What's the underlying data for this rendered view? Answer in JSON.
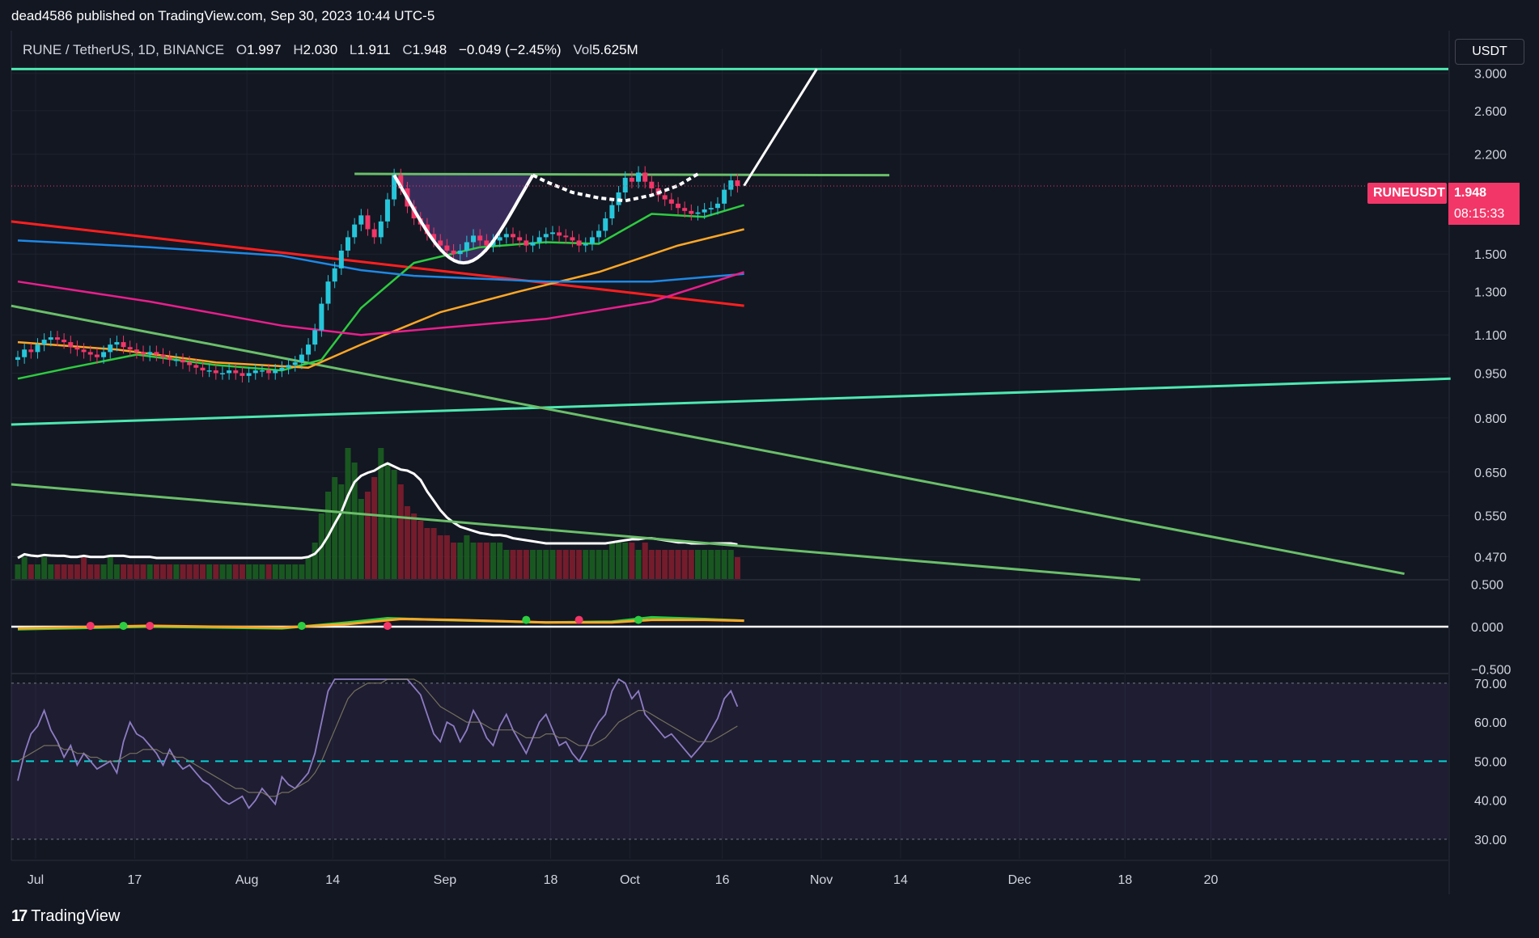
{
  "header": {
    "publish_line": "dead4586 published on TradingView.com, Sep 30, 2023 10:44 UTC-5"
  },
  "legend": {
    "symbol_desc": "RUNE / TetherUS, 1D, BINANCE",
    "o_label": "O",
    "o_value": "1.997",
    "h_label": "H",
    "h_value": "2.030",
    "l_label": "L",
    "l_value": "1.911",
    "c_label": "C",
    "c_value": "1.948",
    "change": "−0.049 (−2.45%)",
    "vol_label": "Vol",
    "vol_value": "5.625M"
  },
  "currency_button": "USDT",
  "last_price": {
    "symbol": "RUNEUSDT",
    "value": "1.948",
    "countdown": "08:15:33"
  },
  "footer": {
    "brand": "TradingView",
    "icon": "tradingview-logo-icon"
  },
  "colors": {
    "background": "#131722",
    "up": "#26c6da",
    "down": "#f23668",
    "resistance": "#4de8b0",
    "neckline": "#6abf69",
    "ma20": "#2ecc40",
    "ma50": "#ffa726",
    "ma100": "#1e88e5",
    "ma200": "#e91e8c",
    "trend_red": "#ff1f1f",
    "rsi": "#8e7cc3",
    "rsi_mid": "#00d4d4"
  },
  "chart_data": [
    {
      "type": "candlestick",
      "panel": "price",
      "scale": "log",
      "ylim": [
        0.43,
        3.3
      ],
      "y_ticks": [
        "3.000",
        "2.600",
        "2.200",
        "1.500",
        "1.300",
        "1.100",
        "0.950",
        "0.800",
        "0.650",
        "0.550",
        "0.470"
      ],
      "x_ticks": [
        "Jul",
        "17",
        "Aug",
        "14",
        "Sep",
        "18",
        "Oct",
        "16",
        "Nov",
        "14",
        "Dec",
        "18",
        "20"
      ],
      "close_series": [
        1.01,
        1.04,
        1.03,
        1.06,
        1.08,
        1.09,
        1.08,
        1.07,
        1.05,
        1.04,
        1.03,
        1.02,
        1.01,
        1.03,
        1.06,
        1.07,
        1.05,
        1.04,
        1.03,
        1.02,
        1.03,
        1.02,
        1.01,
        1.0,
        1.0,
        0.99,
        0.98,
        0.97,
        0.96,
        0.96,
        0.95,
        0.95,
        0.96,
        0.95,
        0.94,
        0.95,
        0.96,
        0.96,
        0.95,
        0.96,
        0.97,
        0.98,
        0.99,
        1.02,
        1.06,
        1.12,
        1.24,
        1.35,
        1.42,
        1.52,
        1.6,
        1.68,
        1.74,
        1.65,
        1.6,
        1.7,
        1.85,
        2.03,
        1.93,
        1.8,
        1.72,
        1.68,
        1.62,
        1.58,
        1.55,
        1.52,
        1.5,
        1.52,
        1.57,
        1.61,
        1.58,
        1.55,
        1.58,
        1.6,
        1.62,
        1.6,
        1.58,
        1.55,
        1.57,
        1.6,
        1.62,
        1.63,
        1.61,
        1.6,
        1.58,
        1.55,
        1.56,
        1.6,
        1.64,
        1.72,
        1.81,
        1.9,
        2.01,
        1.98,
        2.05,
        1.98,
        1.93,
        1.88,
        1.85,
        1.82,
        1.79,
        1.77,
        1.75,
        1.76,
        1.78,
        1.79,
        1.82,
        1.92,
        1.99,
        1.948
      ],
      "series": [
        {
          "name": "",
          "kind": "moving-average",
          "color": "#2ecc40",
          "points": [
            [
              0,
              0.93
            ],
            [
              8,
              0.97
            ],
            [
              18,
              1.02
            ],
            [
              30,
              0.98
            ],
            [
              40,
              0.96
            ],
            [
              46,
              1.0
            ],
            [
              52,
              1.22
            ],
            [
              60,
              1.45
            ],
            [
              70,
              1.54
            ],
            [
              80,
              1.57
            ],
            [
              88,
              1.56
            ],
            [
              96,
              1.75
            ],
            [
              104,
              1.73
            ],
            [
              110,
              1.81
            ]
          ]
        },
        {
          "name": "",
          "kind": "moving-average",
          "color": "#ffa726",
          "points": [
            [
              0,
              1.07
            ],
            [
              15,
              1.04
            ],
            [
              30,
              0.99
            ],
            [
              44,
              0.97
            ],
            [
              52,
              1.06
            ],
            [
              64,
              1.2
            ],
            [
              76,
              1.3
            ],
            [
              88,
              1.4
            ],
            [
              100,
              1.55
            ],
            [
              110,
              1.65
            ]
          ]
        },
        {
          "name": "",
          "kind": "moving-average",
          "color": "#1e88e5",
          "points": [
            [
              0,
              1.58
            ],
            [
              20,
              1.54
            ],
            [
              40,
              1.49
            ],
            [
              52,
              1.41
            ],
            [
              60,
              1.38
            ],
            [
              80,
              1.35
            ],
            [
              96,
              1.35
            ],
            [
              110,
              1.39
            ]
          ]
        },
        {
          "name": "",
          "kind": "moving-average",
          "color": "#e91e8c",
          "points": [
            [
              0,
              1.35
            ],
            [
              20,
              1.25
            ],
            [
              40,
              1.14
            ],
            [
              52,
              1.1
            ],
            [
              64,
              1.13
            ],
            [
              80,
              1.17
            ],
            [
              96,
              1.25
            ],
            [
              110,
              1.4
            ]
          ]
        }
      ],
      "annotations": [
        {
          "kind": "horizontal-line",
          "price": 3.05,
          "color": "#4de8b0"
        },
        {
          "kind": "trendline",
          "from": [
            -1,
            0.78
          ],
          "to": [
            217,
            0.93
          ],
          "color": "#4de8b0"
        },
        {
          "kind": "neckline",
          "from": [
            51,
            2.04
          ],
          "to": [
            132,
            2.03
          ],
          "color": "#6abf69"
        },
        {
          "kind": "trendline",
          "from": [
            -1,
            1.7
          ],
          "to": [
            110,
            1.23
          ],
          "color": "#ff1f1f"
        },
        {
          "kind": "trendline",
          "from": [
            -1,
            1.23
          ],
          "to": [
            210,
            0.44
          ],
          "color": "#6abf69"
        },
        {
          "kind": "trendline",
          "from": [
            -1,
            0.62
          ],
          "to": [
            170,
            0.43
          ],
          "color": "#6abf69"
        },
        {
          "kind": "cup",
          "color": "#ffffff"
        },
        {
          "kind": "projection",
          "from": [
            110,
            1.95
          ],
          "to": [
            121,
            3.05
          ],
          "color": "#ffffff"
        }
      ]
    },
    {
      "type": "bar",
      "panel": "volume",
      "note": "volume histogram with moving-average overlay, shares price panel",
      "values": [
        2,
        3,
        2,
        2,
        3,
        2,
        2,
        2,
        2,
        2,
        3,
        2,
        2,
        2,
        3,
        2,
        2,
        2,
        2,
        2,
        2,
        2,
        2,
        2,
        2,
        2,
        2,
        2,
        2,
        2,
        2,
        2,
        2,
        2,
        2,
        2,
        2,
        2,
        2,
        2,
        2,
        2,
        2,
        2,
        3,
        5,
        9,
        12,
        14,
        13,
        18,
        16,
        11,
        12,
        14,
        18,
        16,
        15,
        13,
        10,
        9,
        8,
        7,
        7,
        6,
        6,
        5,
        5,
        6,
        5,
        5,
        5,
        5,
        5,
        4,
        4,
        4,
        4,
        4,
        4,
        4,
        4,
        4,
        4,
        4,
        4,
        4,
        4,
        4,
        4,
        5,
        5,
        5,
        5,
        4,
        5,
        4,
        4,
        4,
        4,
        4,
        4,
        4,
        4,
        4,
        4,
        4,
        4,
        4,
        3
      ]
    },
    {
      "type": "line",
      "panel": "macd",
      "ylim": [
        -0.55,
        0.55
      ],
      "y_ticks": [
        "0.500",
        "0.000",
        "−0.500"
      ],
      "series": [
        {
          "name": "",
          "color": "#2ecc40",
          "points": [
            [
              0,
              -0.03
            ],
            [
              20,
              0.0
            ],
            [
              40,
              -0.02
            ],
            [
              50,
              0.05
            ],
            [
              56,
              0.1
            ],
            [
              64,
              0.08
            ],
            [
              80,
              0.05
            ],
            [
              90,
              0.06
            ],
            [
              96,
              0.11
            ],
            [
              104,
              0.09
            ],
            [
              110,
              0.07
            ]
          ]
        },
        {
          "name": "",
          "color": "#ffa726",
          "points": [
            [
              0,
              -0.02
            ],
            [
              20,
              0.01
            ],
            [
              40,
              -0.01
            ],
            [
              50,
              0.03
            ],
            [
              58,
              0.09
            ],
            [
              66,
              0.08
            ],
            [
              80,
              0.05
            ],
            [
              90,
              0.05
            ],
            [
              96,
              0.08
            ],
            [
              104,
              0.08
            ],
            [
              110,
              0.07
            ]
          ]
        }
      ]
    },
    {
      "type": "line",
      "panel": "rsi",
      "ylim": [
        25,
        71
      ],
      "y_ticks": [
        "70.00",
        "60.00",
        "50.00",
        "40.00",
        "30.00"
      ],
      "upper": 70,
      "mid": 50,
      "lower": 30,
      "values": [
        45,
        52,
        57,
        59,
        63,
        58,
        55,
        51,
        54,
        49,
        52,
        50,
        48,
        49,
        50,
        47,
        55,
        60,
        57,
        56,
        54,
        52,
        49,
        53,
        50,
        48,
        49,
        47,
        45,
        44,
        42,
        40,
        39,
        40,
        41,
        38,
        40,
        43,
        41,
        39,
        46,
        44,
        43,
        45,
        47,
        52,
        60,
        68,
        75,
        80,
        85,
        83,
        78,
        74,
        72,
        71,
        75,
        80,
        78,
        72,
        69,
        67,
        62,
        57,
        55,
        60,
        59,
        55,
        58,
        63,
        60,
        56,
        54,
        59,
        62,
        58,
        55,
        52,
        56,
        60,
        62,
        58,
        54,
        55,
        52,
        50,
        53,
        57,
        60,
        62,
        68,
        72,
        70,
        66,
        68,
        62,
        60,
        58,
        56,
        57,
        55,
        53,
        51,
        53,
        55,
        58,
        61,
        66,
        68,
        64
      ],
      "signal_values": [
        50,
        51,
        52,
        53,
        54,
        54,
        54,
        53,
        53,
        52,
        52,
        51,
        51,
        50,
        50,
        50,
        51,
        52,
        52,
        53,
        53,
        53,
        52,
        52,
        51,
        51,
        50,
        49,
        48,
        47,
        46,
        45,
        44,
        43,
        43,
        42,
        42,
        42,
        41,
        41,
        42,
        42,
        43,
        44,
        45,
        47,
        50,
        54,
        58,
        62,
        66,
        68,
        69,
        70,
        70,
        70,
        71,
        72,
        72,
        72,
        71,
        70,
        68,
        66,
        64,
        63,
        62,
        61,
        60,
        60,
        60,
        59,
        58,
        58,
        58,
        58,
        57,
        56,
        56,
        56,
        57,
        57,
        56,
        56,
        55,
        54,
        54,
        54,
        55,
        56,
        58,
        60,
        61,
        62,
        63,
        63,
        62,
        61,
        60,
        59,
        58,
        57,
        56,
        55,
        55,
        55,
        56,
        57,
        58,
        59
      ]
    }
  ]
}
